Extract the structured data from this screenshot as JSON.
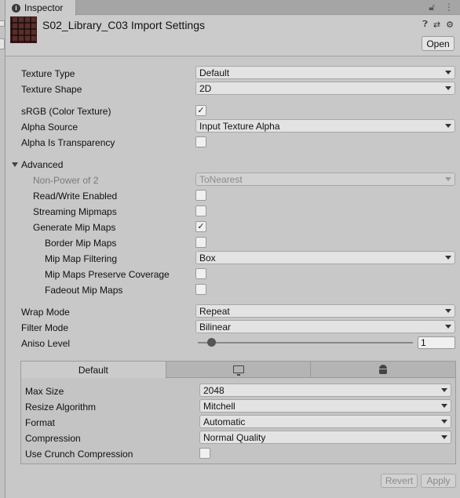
{
  "tab": {
    "title": "Inspector",
    "icon": "info-icon"
  },
  "header": {
    "title": "S02_Library_C03 Import Settings",
    "open_label": "Open"
  },
  "fields": {
    "texture_type": {
      "label": "Texture Type",
      "value": "Default"
    },
    "texture_shape": {
      "label": "Texture Shape",
      "value": "2D"
    },
    "srgb": {
      "label": "sRGB (Color Texture)",
      "checked": true
    },
    "alpha_source": {
      "label": "Alpha Source",
      "value": "Input Texture Alpha"
    },
    "alpha_is_transparency": {
      "label": "Alpha Is Transparency",
      "checked": false
    },
    "advanced": {
      "label": "Advanced"
    },
    "non_power_of_2": {
      "label": "Non-Power of 2",
      "value": "ToNearest"
    },
    "read_write": {
      "label": "Read/Write Enabled",
      "checked": false
    },
    "streaming_mipmaps": {
      "label": "Streaming Mipmaps",
      "checked": false
    },
    "generate_mip_maps": {
      "label": "Generate Mip Maps",
      "checked": true
    },
    "border_mip_maps": {
      "label": "Border Mip Maps",
      "checked": false
    },
    "mip_map_filtering": {
      "label": "Mip Map Filtering",
      "value": "Box"
    },
    "mip_maps_preserve_coverage": {
      "label": "Mip Maps Preserve Coverage",
      "checked": false
    },
    "fadeout_mip_maps": {
      "label": "Fadeout Mip Maps",
      "checked": false
    },
    "wrap_mode": {
      "label": "Wrap Mode",
      "value": "Repeat"
    },
    "filter_mode": {
      "label": "Filter Mode",
      "value": "Bilinear"
    },
    "aniso_level": {
      "label": "Aniso Level",
      "value": "1"
    }
  },
  "platform": {
    "tabs": [
      "Default",
      "",
      ""
    ],
    "max_size": {
      "label": "Max Size",
      "value": "2048"
    },
    "resize_algorithm": {
      "label": "Resize Algorithm",
      "value": "Mitchell"
    },
    "format": {
      "label": "Format",
      "value": "Automatic"
    },
    "compression": {
      "label": "Compression",
      "value": "Normal Quality"
    },
    "crunch": {
      "label": "Use Crunch Compression",
      "checked": false
    }
  },
  "footer": {
    "revert_label": "Revert",
    "apply_label": "Apply"
  },
  "check_glyph": "✓"
}
